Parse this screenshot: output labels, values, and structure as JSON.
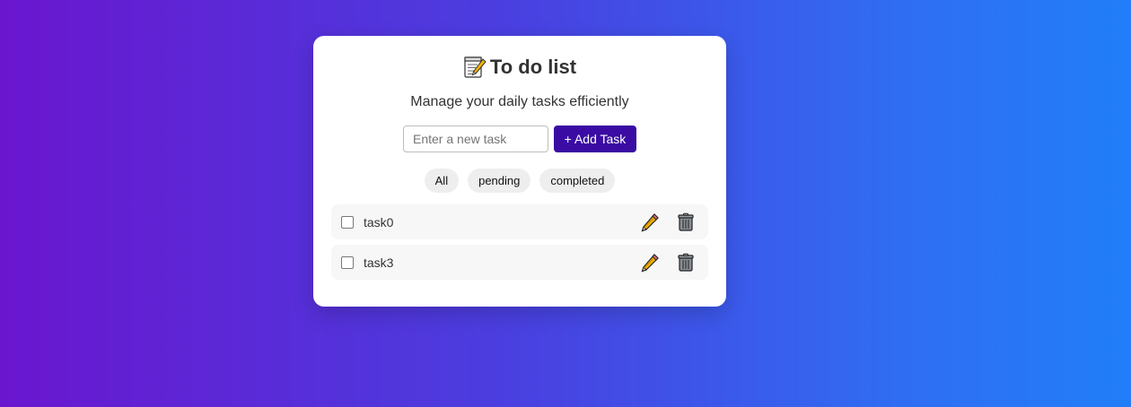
{
  "app": {
    "title": "To do list",
    "subtitle": "Manage your daily tasks efficiently",
    "title_icon": "memo-icon"
  },
  "add_task": {
    "input_placeholder": "Enter a new task",
    "input_value": "",
    "button_label": "+ Add Task"
  },
  "filters": [
    {
      "label": "All"
    },
    {
      "label": "pending"
    },
    {
      "label": "completed"
    }
  ],
  "tasks": [
    {
      "label": "task0",
      "completed": false,
      "edit_icon": "pencil-icon",
      "delete_icon": "trash-icon"
    },
    {
      "label": "task3",
      "completed": false,
      "edit_icon": "pencil-icon",
      "delete_icon": "trash-icon"
    }
  ],
  "colors": {
    "accent": "#3a0ca3",
    "gradient_start": "#6a16cf",
    "gradient_end": "#217ef8"
  }
}
